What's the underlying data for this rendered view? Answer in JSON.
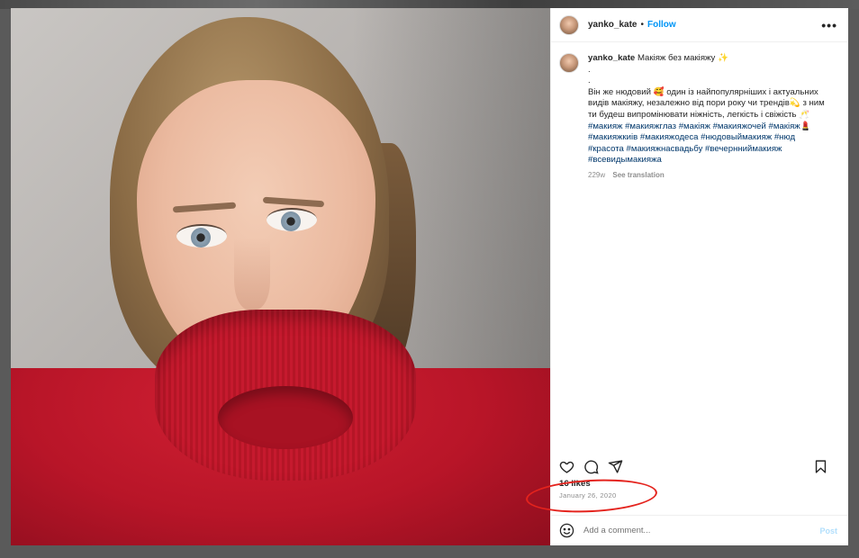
{
  "post": {
    "username": "yanko_kate",
    "separator": "•",
    "follow_label": "Follow",
    "more_label": "•••"
  },
  "caption": {
    "username": "yanko_kate",
    "title": "Макіяж без макіяжу ✨",
    "dot1": ".",
    "dot2": ".",
    "line1": "Він же нюдовий 🥰 один із найпопулярніших і актуальних",
    "line2": "видів макіяжу, незалежно від пори року чи трендів💫 з ним",
    "line3": "ти будеш випромінювати ніжність, легкість і свіжість 🥂",
    "tags1": "#макияж #макияжглаз #макіяж #макияжочей #макіяж💄",
    "tags2": "#макияжкиів #макияжодеса #нюдовыймакияж #нюд",
    "tags3": "#красота #макияжнасвадьбу #вечернниймакияж",
    "tags4": "#всевидымакияжа",
    "age": "229w",
    "see_translation": "See translation"
  },
  "engagement": {
    "likes": "16 likes",
    "date": "January 26, 2020"
  },
  "comment": {
    "placeholder": "Add a comment...",
    "post_label": "Post"
  },
  "colors": {
    "follow": "#0095f6",
    "hashtag": "#00376b",
    "annotation": "#e4231d"
  },
  "icons": [
    "heart-icon",
    "comment-icon",
    "share-icon",
    "bookmark-icon",
    "emoji-icon"
  ]
}
